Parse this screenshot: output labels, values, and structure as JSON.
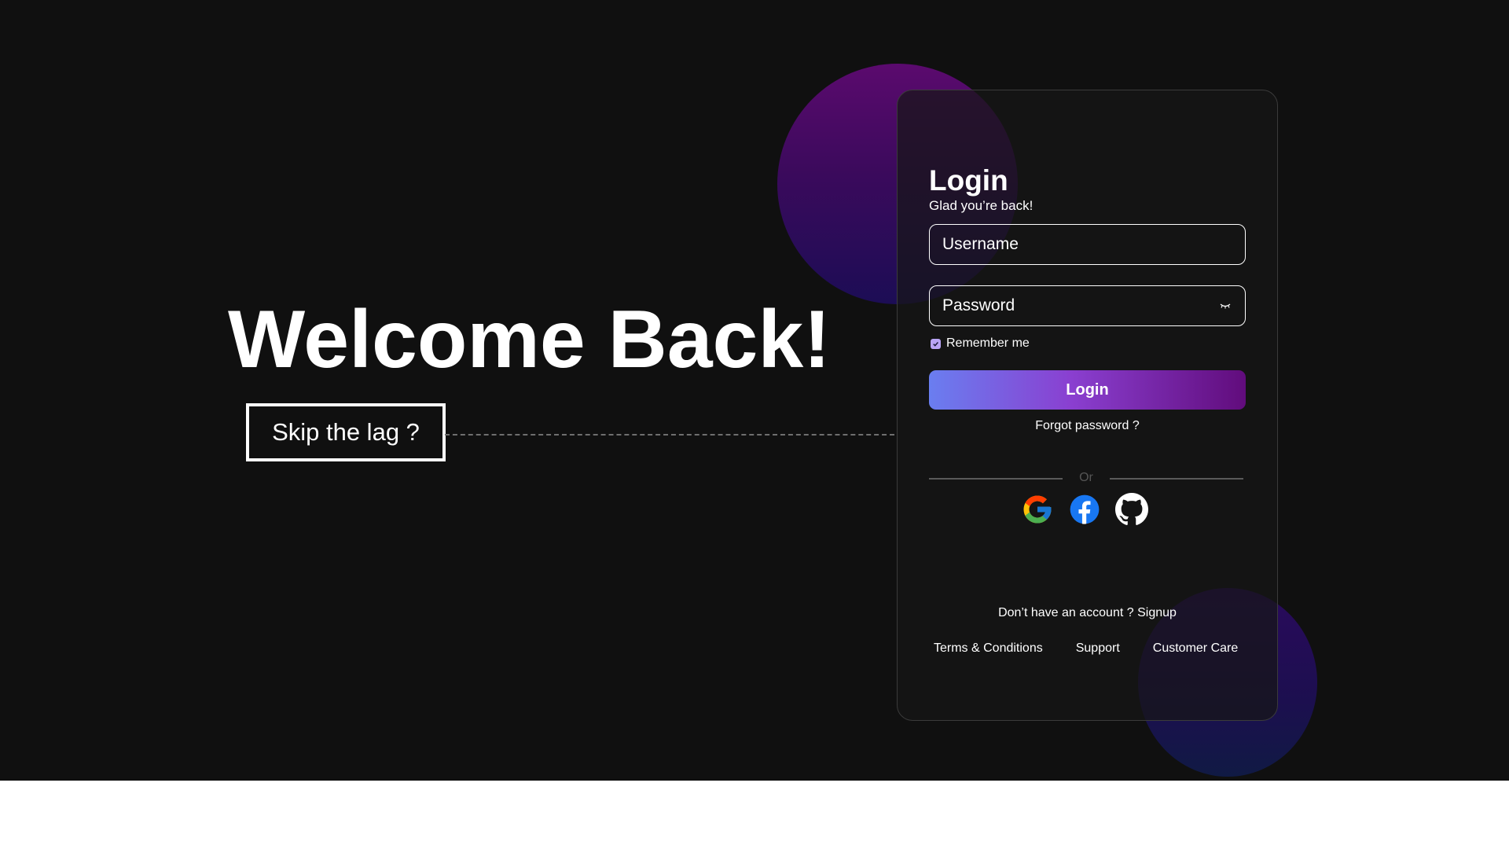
{
  "hero": {
    "title": "Welcome Back!",
    "skip_label": "Skip the lag ?"
  },
  "login_card": {
    "title": "Login",
    "subtitle": "Glad you’re back!",
    "username_placeholder": "Username",
    "password_placeholder": "Password",
    "remember_label": "Remember me",
    "remember_checked": true,
    "login_button": "Login",
    "forgot_label": "Forgot password ?",
    "divider_label": "Or",
    "social_icons": [
      "google-icon",
      "facebook-icon",
      "github-icon"
    ],
    "signup_prompt": "Don’t have an account ?",
    "signup_link": "Signup",
    "footer_links": {
      "terms": "Terms & Conditions",
      "support": "Support",
      "customer_care": "Customer Care"
    }
  },
  "colors": {
    "background": "#101010",
    "login_gradient_start": "#6a7ef0",
    "login_gradient_end": "#610c7c",
    "blob_purple": "#5b0a6e",
    "blob_indigo": "#1c0d55"
  }
}
